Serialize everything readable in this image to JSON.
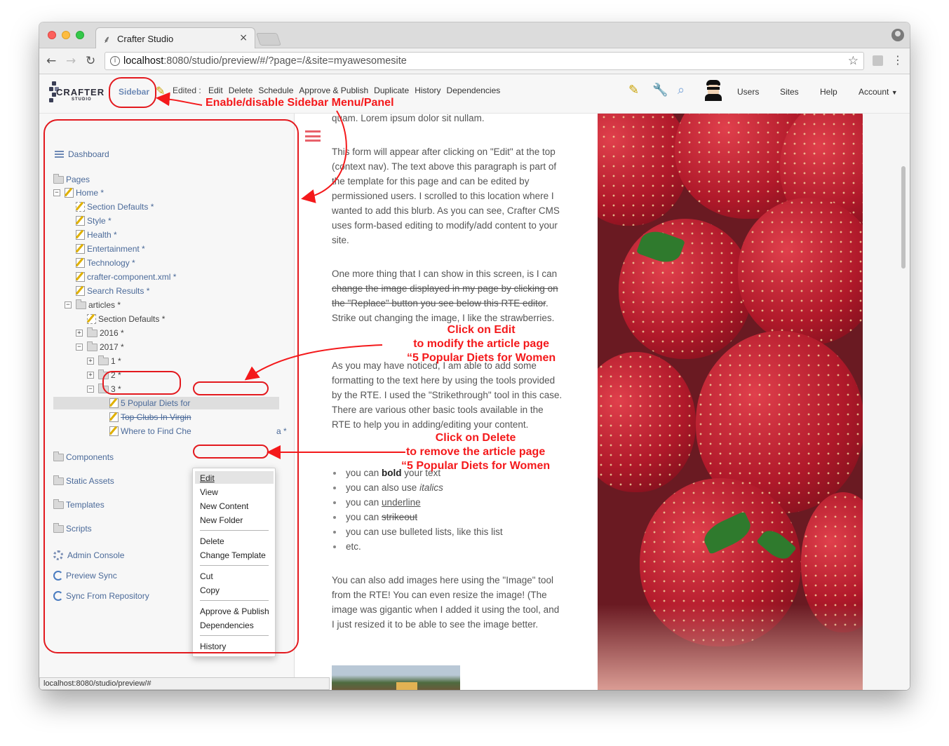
{
  "browser": {
    "tab_title": "Crafter Studio",
    "tab_close": "×",
    "url_host": "localhost",
    "url_rest": ":8080/studio/preview/#/?page=/&site=myawesomesite"
  },
  "toolbar": {
    "logo_text": "CRAFTER",
    "logo_sub": "STUDIO",
    "sidebar_label": "Sidebar",
    "edited_label": "Edited :",
    "actions": [
      "Edit",
      "Delete",
      "Schedule",
      "Approve & Publish",
      "Duplicate",
      "History",
      "Dependencies"
    ],
    "right_links": {
      "users": "Users",
      "sites": "Sites",
      "help": "Help",
      "account": "Account"
    }
  },
  "sidebar": {
    "dashboard": "Dashboard",
    "pages": "Pages",
    "home": "Home *",
    "section_defaults": "Section Defaults *",
    "style": "Style *",
    "health": "Health *",
    "entertainment": "Entertainment *",
    "technology": "Technology *",
    "crafter_component": "crafter-component.xml *",
    "search_results": "Search Results *",
    "articles": "articles *",
    "articles_section_defaults": "Section Defaults *",
    "y2016": "2016 *",
    "y2017": "2017 *",
    "m1": "1 *",
    "m2": "2 *",
    "m3": "3 *",
    "article1": "5 Popular Diets for",
    "article2": "Top Clubs In Virgin",
    "article3": "Where to Find Che",
    "article3_tail": "a *",
    "components": "Components",
    "static_assets": "Static Assets",
    "templates": "Templates",
    "scripts": "Scripts",
    "admin_console": "Admin Console",
    "preview_sync": "Preview Sync",
    "sync_repo": "Sync From Repository"
  },
  "context_menu": {
    "edit": "Edit",
    "view": "View",
    "new_content": "New Content",
    "new_folder": "New Folder",
    "delete": "Delete",
    "change_template": "Change Template",
    "cut": "Cut",
    "copy": "Copy",
    "approve_publish": "Approve & Publish",
    "dependencies": "Dependencies",
    "history": "History"
  },
  "content": {
    "p0": "quam. Lorem ipsum dolor sit nullam.",
    "p1": "This form will appear after clicking on \"Edit\" at the top (context nav).  The text above this paragraph is part of the template for this page and can be edited by permissioned users.  I scrolled to this location where I wanted to add this blurb.  As you can see, Crafter CMS uses form-based editing to modify/add content to your site.",
    "p2_start": "One more thing that I can show in this screen, is I can ",
    "p2_strike": "change the image displayed in my page by clicking on the \"Replace\" button you see below this RTE editor",
    "p2_end": ".  Strike out changing the image, I like the strawberries.",
    "p3": "As you may have noticed, I am able to add some formatting to the text here by using the tools provided by the RTE.  I used the \"Strikethrough\" tool in this case. There are various other basic tools available in the RTE to help you in adding/editing your content.",
    "b1_pre": "you can ",
    "b1_em": "bold",
    "b1_post": " your text",
    "b2_pre": "you can also use ",
    "b2_em": "italics",
    "b3_pre": "you can ",
    "b3_em": "underline",
    "b4_pre": "you can ",
    "b4_em": "strikeout",
    "b5": "you can use bulleted lists, like this list",
    "b6": "etc.",
    "p4": "You can also add images here using the \"Image\" tool from the RTE!  You can even resize the image! (The image was gigantic when I added it using the tool, and I just resized it to be able to see the image better."
  },
  "status_bar": "localhost:8080/studio/preview/#",
  "annotations": {
    "sidebar_note": "Enable/disable Sidebar Menu/Panel",
    "edit_note": [
      "Click on Edit",
      "to modify the article page",
      "“5 Popular Diets for Women"
    ],
    "delete_note": [
      "Click on Delete",
      "to remove the article page",
      "“5 Popular Diets for Women"
    ],
    "accent": "#f4191b"
  }
}
